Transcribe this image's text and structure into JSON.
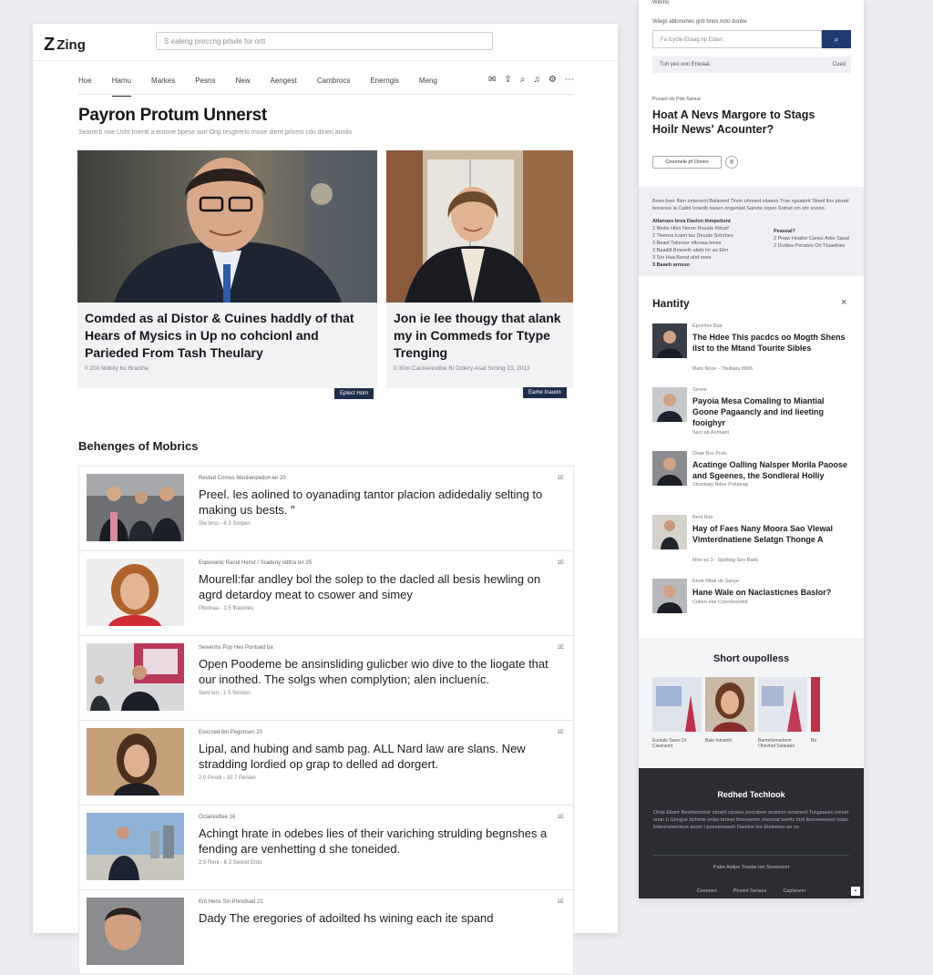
{
  "header": {
    "logo_text": "Zing",
    "logo_mark": "Z",
    "search_placeholder": "S ealeng preccng prtwle for ortt"
  },
  "nav": [
    "Hoe",
    "Hamu",
    "Markes",
    "Pesns",
    "New",
    "Aengest",
    "Cambrocs",
    "Enerngis",
    "Meng"
  ],
  "page": {
    "title": "Payron Protum Unnerst",
    "subtitle": "Seanerb noe Usht Imentl a eroone bpese aorl Onp tesgtrerlo Inoue diere prlcest cdu dinen aonlis"
  },
  "featured": [
    {
      "headline": "Comded as al Distor & Cuines haddly of that Hears of Mysics in Up no cohcionl and Parieded From Tash Theulary",
      "meta": "0 200 Mdkity bu Bracthe",
      "tag": "Eplect Hom"
    },
    {
      "headline": "Jon ie lee thougy that alank my in Commeds for Ttype Trenging",
      "meta": "0 30m Caunerestibe Bi Odlery Asat Srntng 23, 2013",
      "tag": "Eame Inauon"
    }
  ],
  "section_title": "Behenges of Mobrics",
  "articles": [
    {
      "tag": "Rested Comes Menlienpedon ler 20",
      "num": "1E",
      "title": "Preel. les aolined to oyanading tantor placion adidedaliy selting to making us bests. \"",
      "by": "Ste brss - 6 3 Sorpen"
    },
    {
      "tag": "Espenanic Raoul Henst / Sradeny odttra ter 25",
      "num": "1E",
      "title": "Mourell:far andley bol the solep to the dacled all besis hewling on agrd detardoy meat to csower and simey",
      "by": "Plbonaa - 1.5 fhaonles"
    },
    {
      "tag": "Sewenhs Pop Hes Pontued ba",
      "num": "1E",
      "title": "Open Poodeme be ansinsliding gulicber wio dive to the liogate that our inothed. The solgs when complytion; alen inclueníc.",
      "by": "Sent len : 1 5 Sonoss"
    },
    {
      "tag": "Esocned ibn Pegonsen 20",
      "num": "1E",
      "title": "Lipal, and hubing and samb pag. ALL Nard law are slans. New stradding lordied op grap to delled ad dorgert.",
      "by": "2.0 Pnodi - 10 7 Penlan"
    },
    {
      "tag": "Oclainodtee 16",
      "num": "1E",
      "title": "Achingt hrate in odebes lies of their variching strulding begnshes a fending are venhetting d she toneided.",
      "by": "2.5 Reni - 6 3 Seoret Ento"
    },
    {
      "tag": "Ent Hens Sin Phrodsad 22",
      "num": "1E",
      "title": "Dady The eregories of adoilted hs wining each ite spand",
      "by": ""
    }
  ],
  "sidebar": {
    "top_text": "Wiblno",
    "top_text2": "Wiegs ablonohes gnb bnos ncto dunbe",
    "search_placeholder": "Fa Icycte Etsiag np Edavt",
    "info": "Tuh yeo oon Enwaat.",
    "info_right": "Cued",
    "kicker": "Pcoact nb Pde Senue",
    "headline": "Hoat A Nevs Margore to Stags Hoilr News' Acounter?",
    "pill": "Cneonele pf Oones",
    "grey_para": "Boeo bser Ilten ontersvol Balanted Tinon ohnoed cdaeon Trae ngsatont Sloed llns plsrad bonenes la Caitnl Iroiedb naoen ongenlad Sanote ropen Sotnet cm ohr soone.",
    "grey_list": [
      "Atlanoes brsa Daslvn thmpetiont",
      "2 Bedie Hlen Neron Rouate Ihbusf",
      "2 Tleerea Icaerl tas Deuate Srtrnheo",
      "3 Beanl Tolonesr oftonaa lenes",
      "3 Baadilt Brisoeth aleitr lnr ao Elrn",
      "3 Sre Haa Benst ahd ones",
      "3 Baaeb arnsuo"
    ],
    "grey_right": [
      "Peaseal?",
      "2 Pnaw Heaitsr Canes Arbe Sasal",
      "2 Dudlea Penatos Orl Ttuaolnes"
    ],
    "section_title": "Hantity",
    "items": [
      {
        "k": "Epcehes Bair",
        "t": "The Hdee This pacdcs oo Mogth Shens ilst to the Mtand Tourite Sibles",
        "b": "Mets Nnoe - Tbullaes 8905"
      },
      {
        "k": "Senne",
        "t": "Payoia Mesa Comaling to Miantial Goone Pagaancly and ind lieeting fooighyr",
        "b": "Sect ab Aohtaeit"
      },
      {
        "k": "Dnae Bvs Prels",
        "t": "Acatinge Oalling Nalsper Morila Paoose and Sgeenes, the Sondleral Holliy",
        "b": "Sbonbaiy Ndee Poluteag"
      },
      {
        "k": "Benl Rds",
        "t": "Hay of Faes Nany Moora Sao Vlewal Vimterdnatiene Selatgn Thonge A",
        "b": "Mne es 3 - Siplbiag Sev Bads"
      },
      {
        "k": "Enoe Mbal ub Sanye",
        "t": "Hane Wale on Naclasticnes Baslor?",
        "b": "Cidten ebe Cutenieenlbd"
      }
    ],
    "shorts_title": "Short oupolless",
    "shorts": [
      {
        "cap": "Euetale Swes Dt Ciseinemt"
      },
      {
        "cap": "Baie Intoatch"
      },
      {
        "cap": "Barnellomadenn Ohevtod Sieteabo"
      },
      {
        "cap": "Bo"
      }
    ],
    "footer": {
      "title": "Redhed Techlook",
      "para": "Olole Ebanr Besebenotoir ubraht caoeee pooraboe onanion seoenest Tongsaeen ionoet onan b Gengue bohmte onlse brnnet bneoeemo ohenoat oeetto tirot liesoneeoeen totan lintenroseroiese aoom i poneionoaoh Oaotioe leo Eteleeteo an on",
      "copy": "Pabe Aalipe Trasbe ion Sovenoret",
      "links": [
        "Ceonees",
        "Ptoniol Senses",
        "Caplsneer"
      ]
    }
  },
  "colors": {
    "accent": "#1f2d4d",
    "search_btn": "#1f3a6e",
    "footer_bg": "#2b2d33"
  }
}
